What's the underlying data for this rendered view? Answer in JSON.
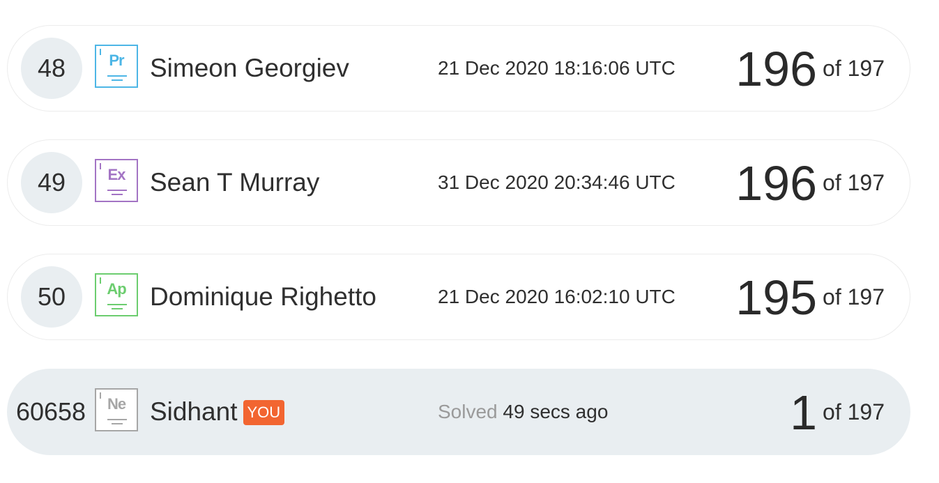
{
  "rows": [
    {
      "rank": "48",
      "badge": {
        "symbol": "Pr",
        "color": "#4db6e6"
      },
      "name": "Simeon Georgiev",
      "date": "21 Dec 2020 18:16:06 UTC",
      "score": "196",
      "of": "of 197"
    },
    {
      "rank": "49",
      "badge": {
        "symbol": "Ex",
        "color": "#a374c4"
      },
      "name": "Sean T Murray",
      "date": "31 Dec 2020 20:34:46 UTC",
      "score": "196",
      "of": "of 197"
    },
    {
      "rank": "50",
      "badge": {
        "symbol": "Ap",
        "color": "#6ccd6f"
      },
      "name": "Dominique Righetto",
      "date": "21 Dec 2020 16:02:10 UTC",
      "score": "195",
      "of": "of 197"
    }
  ],
  "current_user": {
    "rank": "60658",
    "badge": {
      "symbol": "Ne",
      "color": "#a6a6a6"
    },
    "name": "Sidhant",
    "you_label": "YOU",
    "solved_label": "Solved",
    "solved_time": "49 secs ago",
    "score": "1",
    "of": "of 197"
  },
  "colors": {
    "you_tag": "#f26531",
    "highlight_row": "#e9eef1"
  }
}
